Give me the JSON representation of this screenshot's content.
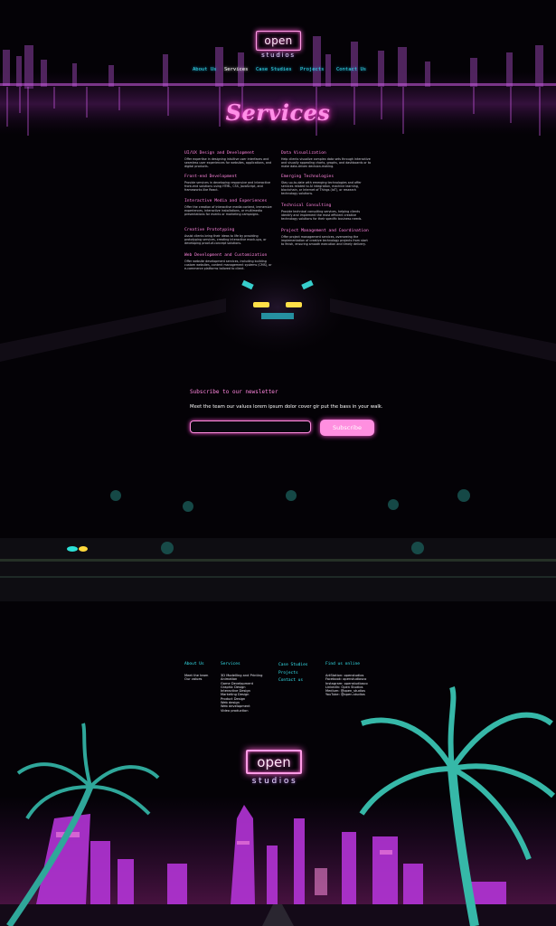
{
  "brand": {
    "name": "open",
    "tagline": "studios"
  },
  "nav": {
    "items": [
      {
        "label": "About Us",
        "active": false
      },
      {
        "label": "Services",
        "active": true
      },
      {
        "label": "Case Studies",
        "active": false
      },
      {
        "label": "Projects",
        "active": false
      },
      {
        "label": "Contact Us",
        "active": false
      }
    ]
  },
  "page": {
    "title": "Services"
  },
  "services": {
    "left": [
      {
        "title": "UI/UX Design and Development",
        "desc": "Offer expertise in designing intuitive user interfaces and seamless user experiences for websites, applications, and digital products."
      },
      {
        "title": "Front-end Development",
        "desc": "Provide services in developing responsive and interactive front-end solutions using HTML, CSS, JavaScript, and frameworks like React."
      },
      {
        "title": "Interactive Media and Experiences",
        "desc": "Offer the creation of interactive media content, immersive experiences, interactive installations, or multimedia presentations for events or marketing campaigns."
      },
      {
        "title": "Creative Prototyping",
        "desc": "Assist clients bring their ideas to life by providing prototyping services, creating interactive mock-ups, or developing proof-of-concept solutions."
      },
      {
        "title": "Web Development and Customization",
        "desc": "Offer website development services, including building custom websites, content management systems (CMS), or e-commerce platforms tailored to client."
      }
    ],
    "right": [
      {
        "title": "Data Visualization",
        "desc": "Help clients visualize complex data sets through interactive and visually appealing charts, graphs, and dashboards or to make data-driven decision-making."
      },
      {
        "title": "Emerging Technologies",
        "desc": "Stay up-to-date with emerging technologies and offer services related to AI integration, machine learning, blockchain, or Internet of Things (IoT), or research technology solutions."
      },
      {
        "title": "Technical Consulting",
        "desc": "Provide technical consulting services, helping clients identify and implement the most efficient creative technology solutions for their specific business needs."
      },
      {
        "title": "Project Management and Coordination",
        "desc": "Offer project management services, overseeing the implementation of creative technology projects from start to finish, ensuring smooth execution and timely delivery."
      }
    ]
  },
  "newsletter": {
    "title": "Subscribe to our newsletter",
    "text": "Meet the team our values lorem ipsum dolor cover gir put the bass in your walk.",
    "placeholder": "",
    "button": "Subscribe"
  },
  "footer": {
    "about": {
      "heading": "About Us",
      "links": [
        "Meet the team",
        "Our values"
      ]
    },
    "services": {
      "heading": "Services",
      "links": [
        "3D Modelling and Printing",
        "Animation",
        "Game Development",
        "Graphic Design",
        "Interactive Design",
        "Marketing Design",
        "Product Design",
        "Web design",
        "Web development",
        "Video production"
      ]
    },
    "misc": {
      "links": [
        "Case Studies",
        "Projects",
        "Contact us"
      ]
    },
    "social": {
      "heading": "Find us online",
      "links": [
        "ArtStation: openstudios",
        "Facebook: openstudiosco",
        "Instagram: openstudiosco",
        "LinkedIn: Open Studios",
        "Medium: @open_studios",
        "YouTube: @open-studios"
      ]
    }
  },
  "colors": {
    "pink": "#ff8fe0",
    "cyan": "#36e6f0",
    "background": "#040206"
  }
}
